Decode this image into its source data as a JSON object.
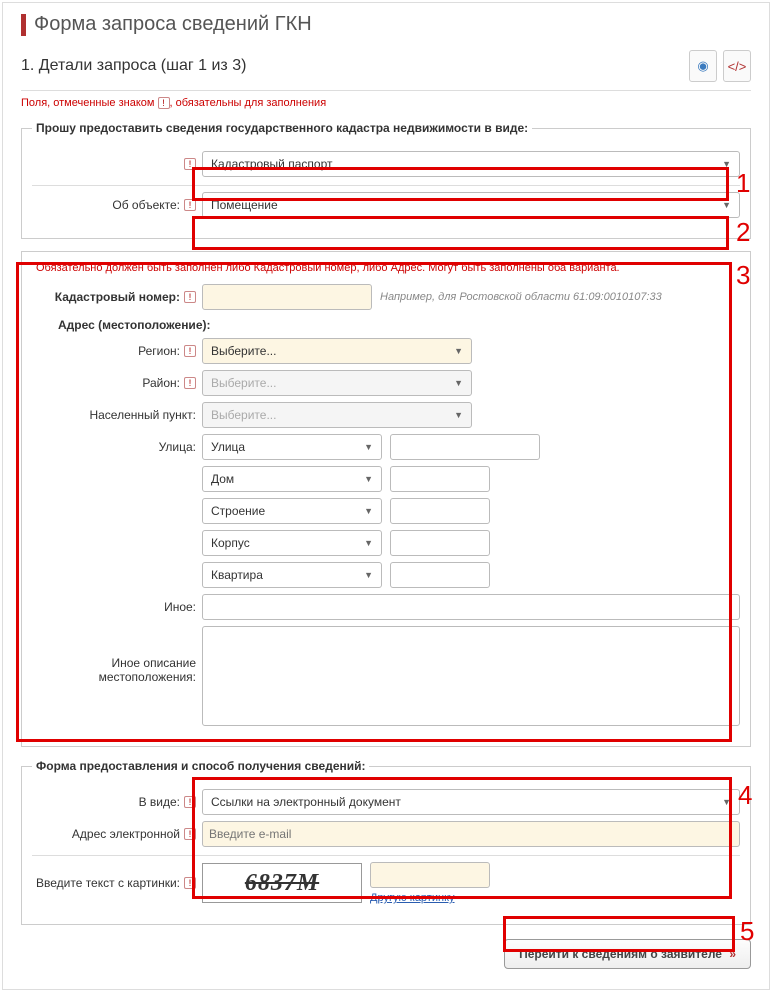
{
  "page_title": "Форма запроса сведений ГКН",
  "step_title": "1. Детали запроса (шаг 1 из 3)",
  "required_note_pre": "Поля, отмеченные знаком ",
  "required_note_post": ", обязательны для заполнения",
  "fieldset1": {
    "legend": "Прошу предоставить сведения государственного кадастра недвижимости в виде:",
    "doc_type_value": "Кадастровый паспорт",
    "object_label": "Об объекте:",
    "object_value": "Помещение"
  },
  "obj_section": {
    "warn": "Обязательно должен быть заполнен либо Кадастровый номер, либо Адрес. Могут быть заполнены оба варианта.",
    "cad_label": "Кадастровый номер:",
    "cad_hint": "Например, для Ростовской области 61:09:0010107:33",
    "addr_header": "Адрес (местоположение):",
    "region_label": "Регион:",
    "region_value": "Выберите...",
    "district_label": "Район:",
    "district_value": "Выберите...",
    "locality_label": "Населенный пункт:",
    "locality_value": "Выберите...",
    "street_label": "Улица:",
    "street_value": "Улица",
    "house_value": "Дом",
    "building_value": "Строение",
    "korpus_value": "Корпус",
    "flat_value": "Квартира",
    "other_label": "Иное:",
    "other_desc_label": "Иное описание местоположения:"
  },
  "delivery": {
    "legend": "Форма предоставления и способ получения сведений:",
    "form_label": "В виде:",
    "form_value": "Ссылки на электронный документ",
    "email_label": "Адрес электронной",
    "email_placeholder": "Введите e-mail"
  },
  "captcha": {
    "label": "Введите текст с картинки:",
    "text": "6837М",
    "another_link": "Другую картинку"
  },
  "submit_label": "Перейти к сведениям о заявителе",
  "annotations": {
    "n1": "1",
    "n2": "2",
    "n3": "3",
    "n4": "4",
    "n5": "5"
  }
}
